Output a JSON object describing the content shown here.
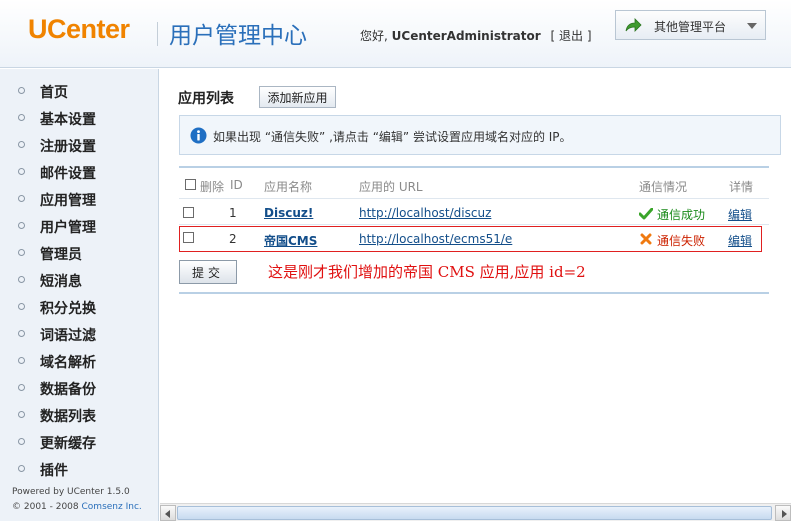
{
  "header": {
    "logo": "UCenter",
    "title": "用户管理中心",
    "greeting_prefix": "您好,",
    "username": "UCenterAdministrator",
    "logout_open": "[",
    "logout_label": "退出",
    "logout_close": "]",
    "platform_label": "其他管理平台"
  },
  "sidebar": {
    "items": [
      {
        "label": "首页"
      },
      {
        "label": "基本设置"
      },
      {
        "label": "注册设置"
      },
      {
        "label": "邮件设置"
      },
      {
        "label": "应用管理"
      },
      {
        "label": "用户管理"
      },
      {
        "label": "管理员"
      },
      {
        "label": "短消息"
      },
      {
        "label": "积分兑换"
      },
      {
        "label": "词语过滤"
      },
      {
        "label": "域名解析"
      },
      {
        "label": "数据备份"
      },
      {
        "label": "数据列表"
      },
      {
        "label": "更新缓存"
      },
      {
        "label": "插件"
      }
    ],
    "powered": "Powered by UCenter 1.5.0",
    "copyright_prefix": "© 2001 - 2008",
    "copyright_company": "Comsenz Inc."
  },
  "main": {
    "title": "应用列表",
    "add_button": "添加新应用",
    "notice": "如果出现 “通信失败” ,请点击 “编辑” 尝试设置应用域名对应的 IP。",
    "columns": {
      "delete": "删除",
      "id": "ID",
      "name": "应用名称",
      "url": "应用的 URL",
      "status": "通信情况",
      "detail": "详情"
    },
    "rows": [
      {
        "id": "1",
        "name": "Discuz!",
        "url": "http://localhost/discuz",
        "status": "通信成功",
        "edit": "编辑"
      },
      {
        "id": "2",
        "name": "帝国CMS",
        "url": "http://localhost/ecms51/e",
        "status": "通信失败",
        "edit": "编辑"
      }
    ],
    "submit_button": "提交",
    "annotation": "这是刚才我们增加的帝国 CMS 应用,应用 id=2"
  },
  "colors": {
    "logo": "#f08300",
    "title": "#2a6fba",
    "success": "#1a8a1a",
    "failure": "#cc2200",
    "annotation": "#e01010"
  }
}
